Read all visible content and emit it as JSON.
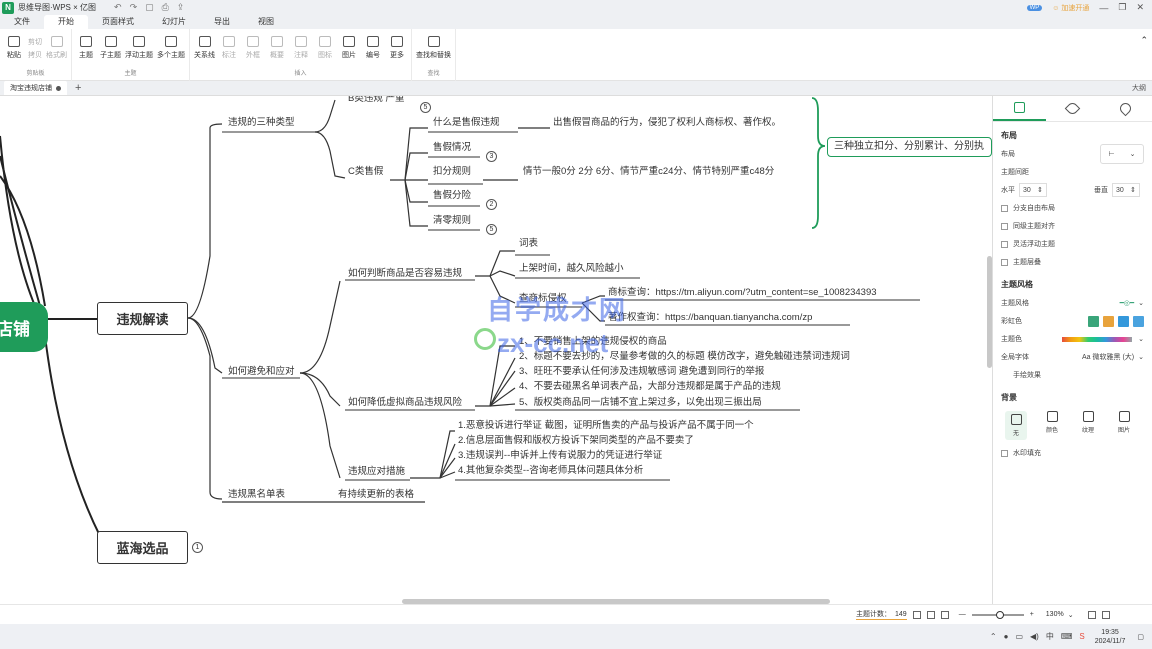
{
  "app": {
    "title": "思维导图·WPS × 亿图",
    "user_badge": "WP",
    "vip_label": "☺ 加速开通",
    "qat_icons": [
      "undo-icon",
      "redo-icon",
      "save-icon",
      "print-icon",
      "export-icon"
    ]
  },
  "menu": {
    "tabs": [
      "文件",
      "开始",
      "页面样式",
      "幻灯片",
      "导出",
      "视图"
    ],
    "active": "开始"
  },
  "ribbon": {
    "clipboard": {
      "paste": "粘贴",
      "cut": "剪切",
      "copy": "拷贝",
      "format": "格式刷",
      "label": "剪贴板"
    },
    "topic": {
      "main": "主题",
      "sub": "子主题",
      "float": "浮动主题",
      "multi": "多个主题",
      "label": "主题"
    },
    "insert": {
      "relation": "关系线",
      "tag": "标注",
      "outline": "外框",
      "summary": "概要",
      "note": "注释",
      "icon": "图标",
      "image": "图片",
      "number": "编号",
      "more": "更多",
      "label": "插入"
    },
    "find": {
      "find_replace": "查找和替换",
      "label": "查找"
    }
  },
  "doc": {
    "tab_title": "淘宝违规店铺",
    "outline_label": "大纲"
  },
  "mindmap": {
    "root": "店铺",
    "topic_violation": "违规解读",
    "topic_blue": "蓝海选品",
    "badge_blue": "1",
    "b1": "违规的三种类型",
    "b2": "如何避免和应对",
    "b3": "违规黑名单表",
    "b3_child": "有持续更新的表格",
    "b_type": "B类违规 严重",
    "b_type_badge": "5",
    "c_type": "C类售假",
    "c_children": [
      {
        "label": "什么是售假违规",
        "badge": ""
      },
      {
        "label": "售假情况",
        "badge": "3"
      },
      {
        "label": "扣分规则",
        "badge": ""
      },
      {
        "label": "售假分险",
        "badge": "2"
      },
      {
        "label": "清零规则",
        "badge": "5"
      }
    ],
    "c_desc1": "出售假冒商品的行为，侵犯了权利人商标权、著作权。",
    "c_desc2": "情节一般0分 2分 6分、情节严重c24分、情节特别严重c48分",
    "callout": "三种独立扣分、分别累计、分别执",
    "judge": "如何判断商品是否容易违规",
    "judge_children": [
      "词表",
      "上架时间，越久风险越小",
      "查商标侵权"
    ],
    "link1": "商标查询：https://tm.aliyun.com/?utm_content=se_1008234393",
    "link2": "著作权查询：https://banquan.tianyancha.com/zp",
    "lower": "如何降低虚拟商品违规风险",
    "lower_items": [
      "1、不要销售上架的违规侵权的商品",
      "2、标题不要去抄的，尽量参考做的久的标题 模仿改字，避免触碰违禁词违规词",
      "3、旺旺不要承认任何涉及违规敏感词 避免遭到同行的举报",
      "4、不要去碰黑名单词表产品，大部分违规都是属于产品的违规",
      "5、版权类商品同一店铺不宜上架过多，以免出现三振出局"
    ],
    "respond": "违规应对措施",
    "respond_items": [
      "1.恶意投诉进行举证 截图，证明所售卖的产品与投诉产品不属于同一个",
      "2.信息层面售假和版权方投诉下架同类型的产品不要卖了",
      "3.违规误判--申诉并上传有说服力的凭证进行举证",
      "4.其他复杂类型--咨询老师具体问题具体分析"
    ],
    "watermark1": "自学成才网",
    "watermark2": "zx-cc.net"
  },
  "panel": {
    "section_layout": "布局",
    "layout_label": "布局",
    "spacing_label": "主题间距",
    "h_label": "水平",
    "h_value": "30",
    "v_label": "垂直",
    "v_value": "30",
    "checks": [
      "分支自由布局",
      "同级主题对齐",
      "灵活浮动主题",
      "主题层叠"
    ],
    "section_style": "主题风格",
    "style_label": "主题风格",
    "rainbow_label": "彩虹色",
    "color_label": "主题色",
    "font_label": "全局字体",
    "font_value": "Aa 微软雅黑 (大)",
    "hand_label": "手绘效果",
    "section_bg": "背景",
    "bg_options": [
      "无",
      "颜色",
      "纹理",
      "图片"
    ],
    "watermark_label": "水印填充",
    "swatch_colors": [
      "#3aa57a",
      "#e8a33c",
      "#3498db",
      "#4aa3df"
    ]
  },
  "status": {
    "count_label": "主题计数：",
    "count_value": "149",
    "zoom": "130%"
  },
  "taskbar": {
    "time": "19:35",
    "date": "2024/11/7",
    "ime": "中"
  }
}
